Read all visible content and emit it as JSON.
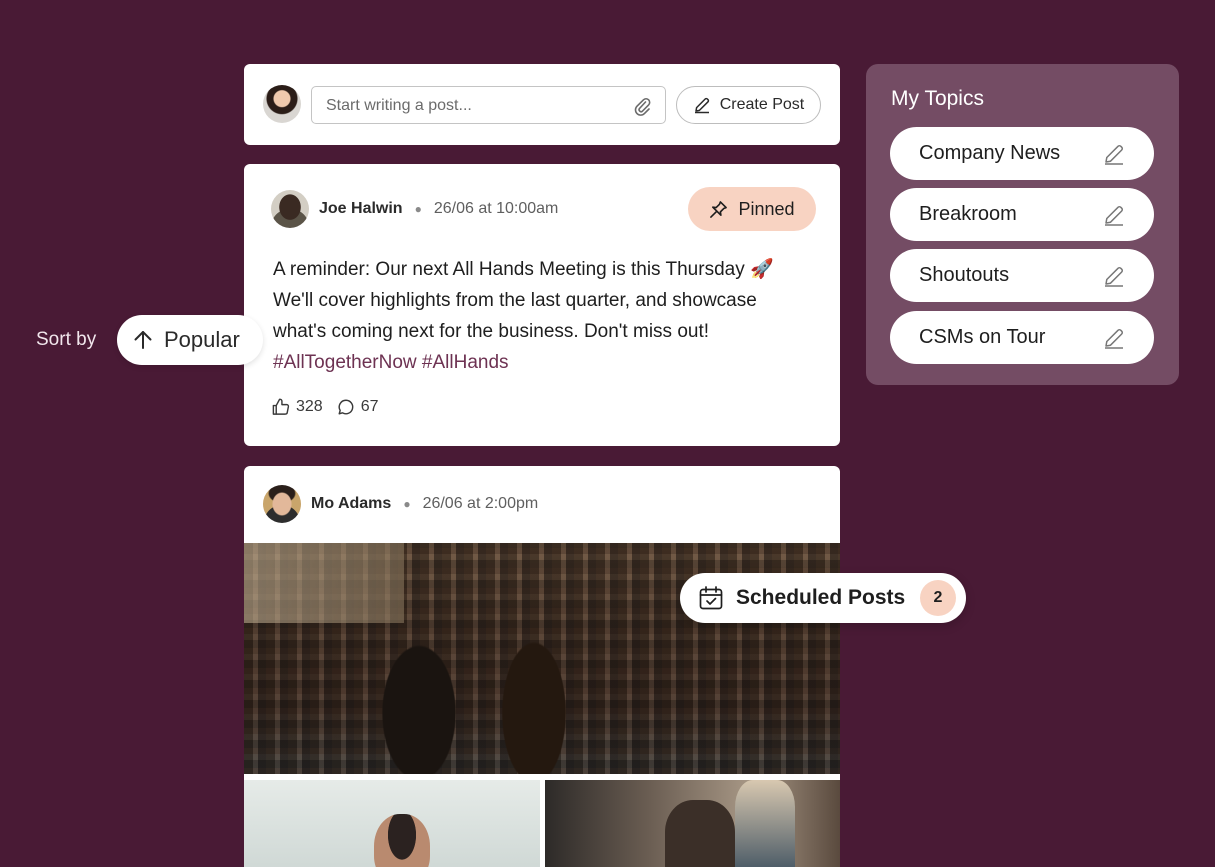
{
  "composer": {
    "placeholder": "Start writing a post...",
    "create_label": "Create Post"
  },
  "posts": [
    {
      "author": "Joe Halwin",
      "time": "26/06 at 10:00am",
      "badge": "Pinned",
      "body": "A reminder: Our next All Hands Meeting is this Thursday 🚀 We'll cover highlights from the last quarter, and showcase what's coming next for the business. Don't miss out!",
      "tags": "#AllTogetherNow #AllHands",
      "likes": "328",
      "comments": "67"
    },
    {
      "author": "Mo Adams",
      "time": "26/06 at 2:00pm"
    }
  ],
  "sort": {
    "label": "Sort by",
    "value": "Popular"
  },
  "scheduled": {
    "label": "Scheduled Posts",
    "count": "2"
  },
  "topics": {
    "title": "My Topics",
    "items": [
      {
        "label": "Company News"
      },
      {
        "label": "Breakroom"
      },
      {
        "label": "Shoutouts"
      },
      {
        "label": "CSMs on Tour"
      }
    ]
  },
  "colors": {
    "background": "#491a35",
    "panel": "#744c64",
    "accent_peach": "#f8d3c2",
    "hashtag": "#6d3252"
  },
  "icons": [
    "paperclip-icon",
    "pencil-icon",
    "pin-icon",
    "thumbs-up-icon",
    "comment-icon",
    "arrow-up-icon",
    "calendar-check-icon"
  ]
}
